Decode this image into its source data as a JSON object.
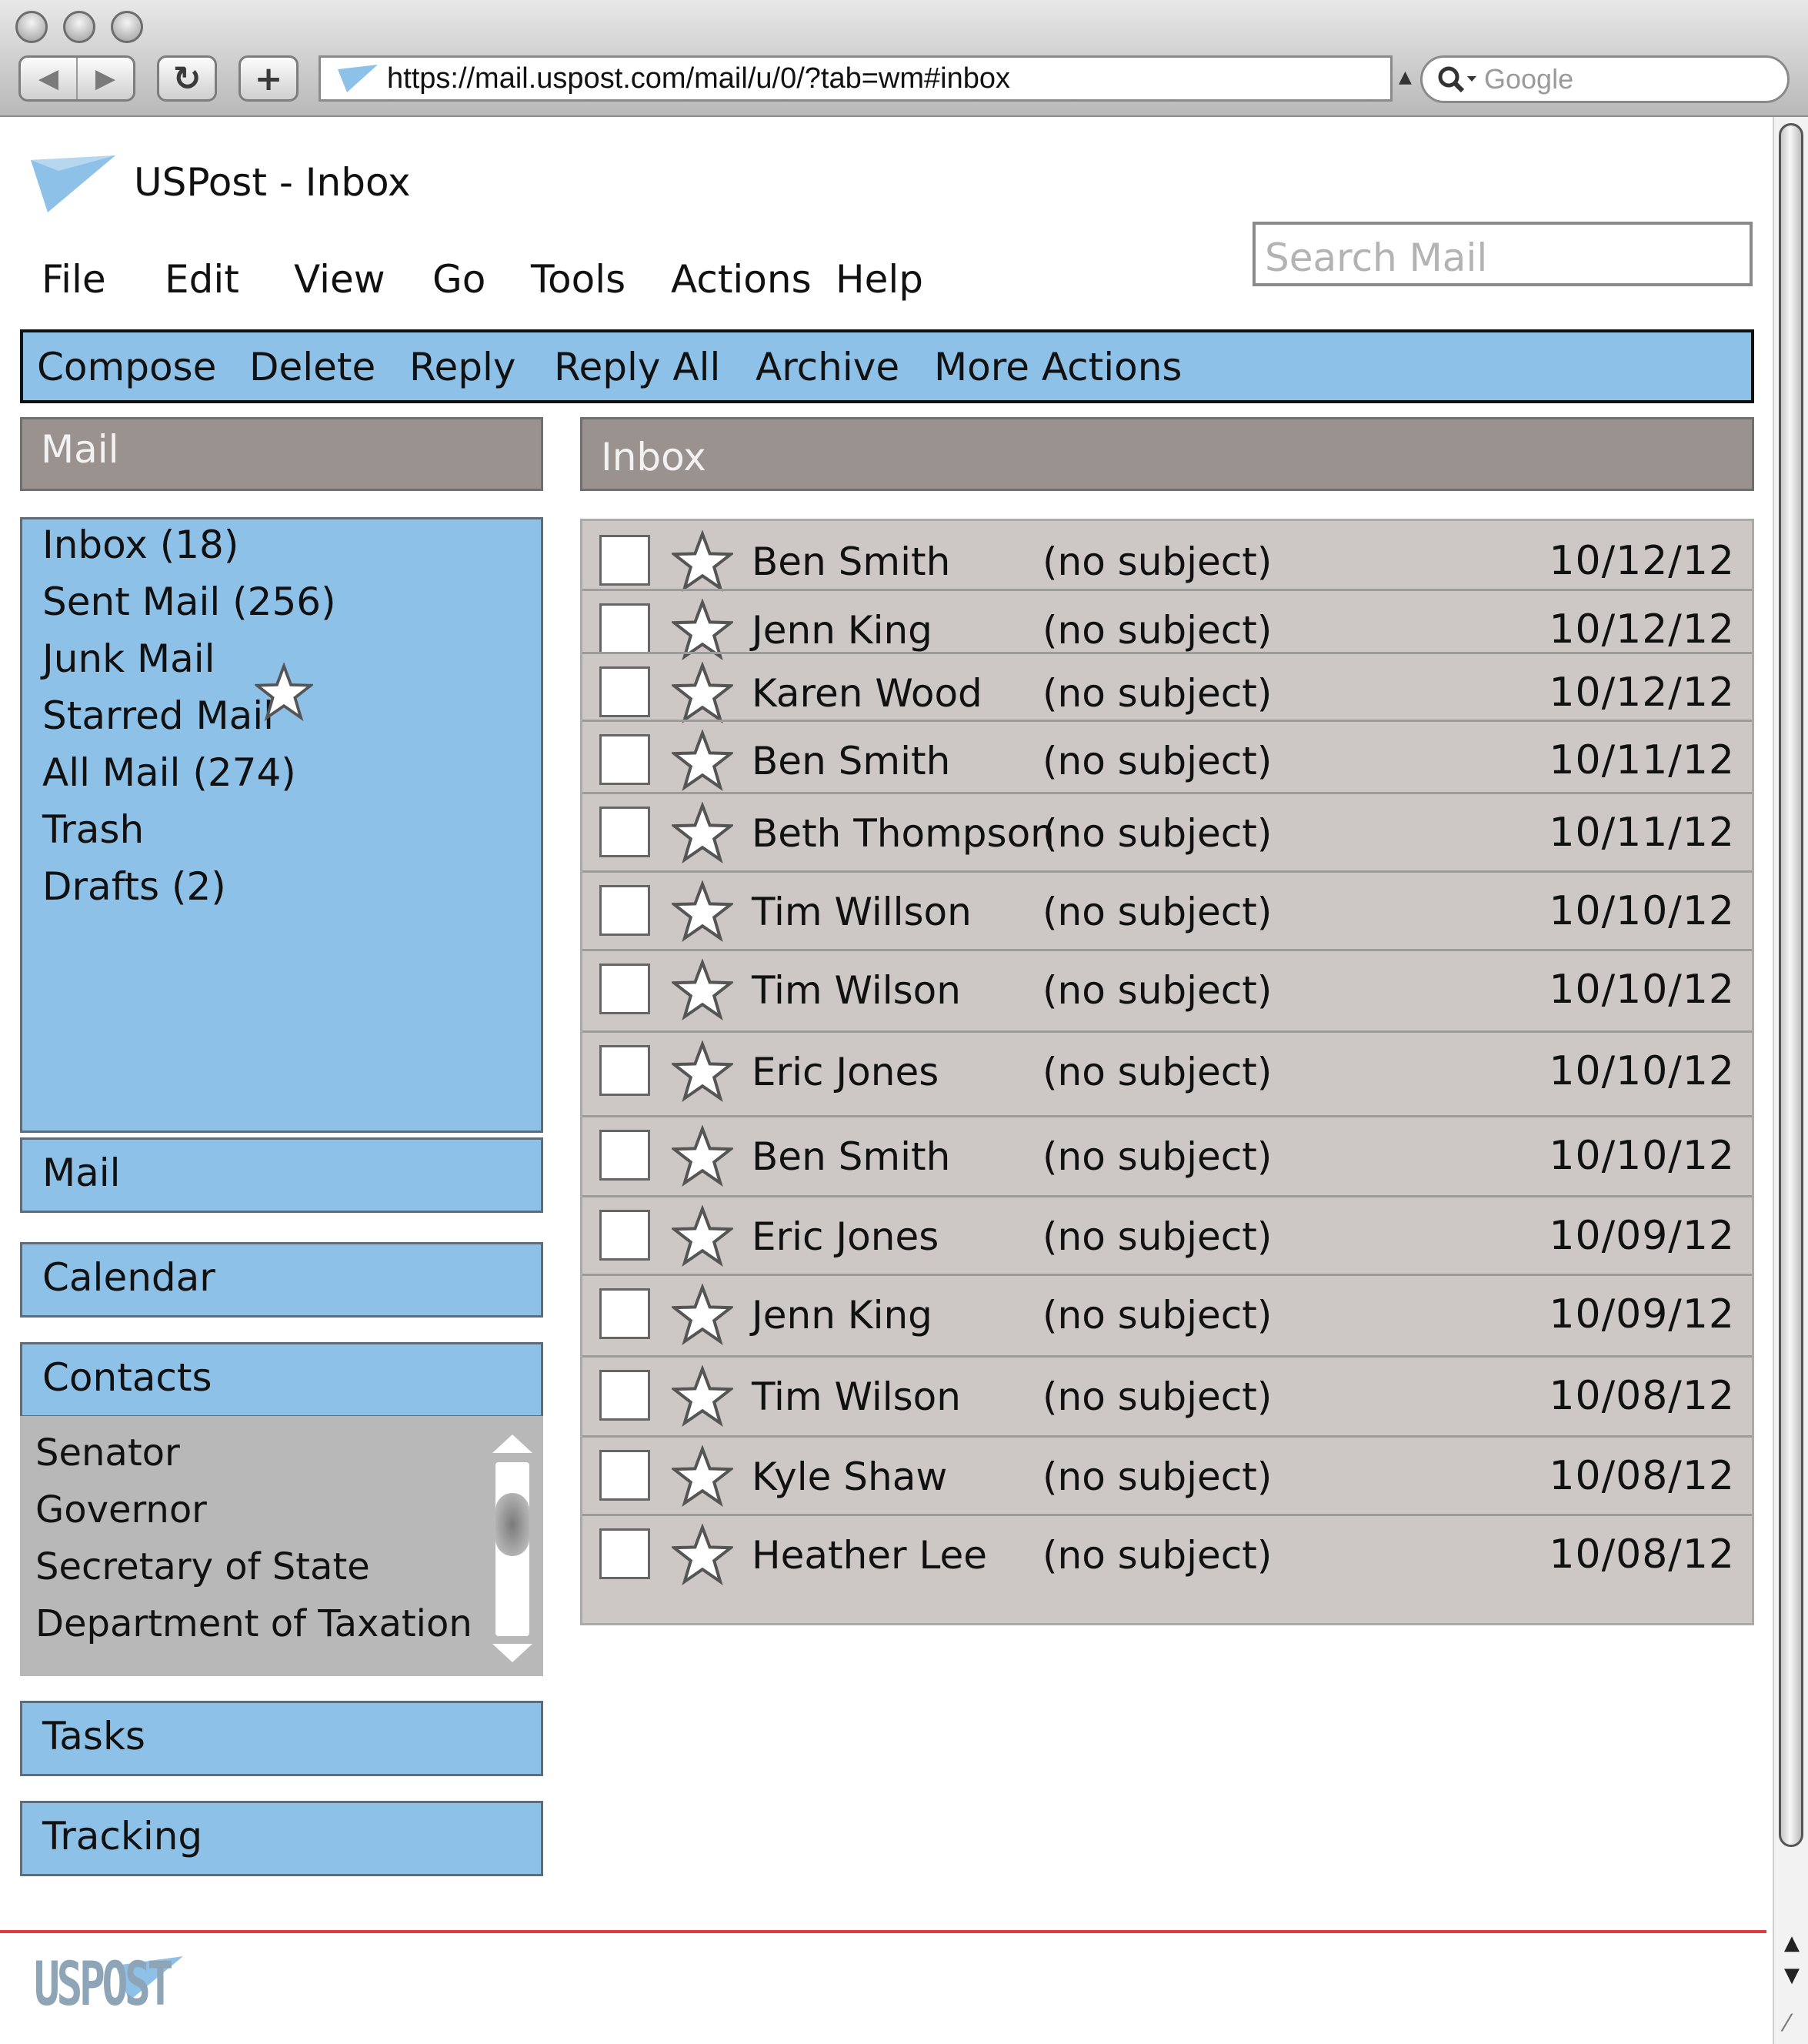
{
  "browser": {
    "url": "https://mail.uspost.com/mail/u/0/?tab=wm#inbox",
    "search_placeholder": "Google",
    "back_icon": "back-arrow-icon",
    "forward_icon": "forward-arrow-icon",
    "reload_icon": "reload-icon",
    "new_tab_icon": "plus-icon"
  },
  "app": {
    "title": "USPost - Inbox",
    "footer_brand": "USPOST",
    "accent_color": "#8ec1e8",
    "panel_gray": "#9a928e",
    "footer_line_color": "#e23a3a"
  },
  "menu": [
    "File",
    "Edit",
    "View",
    "Go",
    "Tools",
    "Actions",
    "Help"
  ],
  "search": {
    "placeholder": "Search Mail"
  },
  "toolbar": [
    "Compose",
    "Delete",
    "Reply",
    "Reply All",
    "Archive",
    "More Actions"
  ],
  "sidebar": {
    "header": "Mail",
    "folders": [
      "Inbox (18)",
      "Sent Mail (256)",
      "Junk Mail",
      "Starred Mail",
      "All Mail (274)",
      "Trash",
      "Drafts (2)"
    ],
    "sections": {
      "mail": "Mail",
      "calendar": "Calendar",
      "contacts": "Contacts",
      "tasks": "Tasks",
      "tracking": "Tracking"
    },
    "contacts": [
      "Senator",
      "Governor",
      "Secretary of State",
      "Department of Taxation"
    ]
  },
  "inbox": {
    "header": "Inbox",
    "messages": [
      {
        "sender": "Ben Smith",
        "subject": "(no subject)",
        "date": "10/12/12"
      },
      {
        "sender": "Jenn King",
        "subject": "(no subject)",
        "date": "10/12/12"
      },
      {
        "sender": "Karen Wood",
        "subject": "(no subject)",
        "date": "10/12/12"
      },
      {
        "sender": "Ben Smith",
        "subject": "(no subject)",
        "date": "10/11/12"
      },
      {
        "sender": "Beth Thompson",
        "subject": "(no subject)",
        "date": "10/11/12"
      },
      {
        "sender": "Tim Willson",
        "subject": "(no subject)",
        "date": "10/10/12"
      },
      {
        "sender": "Tim Wilson",
        "subject": "(no subject)",
        "date": "10/10/12"
      },
      {
        "sender": "Eric Jones",
        "subject": "(no subject)",
        "date": "10/10/12"
      },
      {
        "sender": "Ben Smith",
        "subject": "(no subject)",
        "date": "10/10/12"
      },
      {
        "sender": "Eric Jones",
        "subject": "(no subject)",
        "date": "10/09/12"
      },
      {
        "sender": "Jenn King",
        "subject": "(no subject)",
        "date": "10/09/12"
      },
      {
        "sender": "Tim Wilson",
        "subject": "(no subject)",
        "date": "10/08/12"
      },
      {
        "sender": "Kyle Shaw",
        "subject": "(no subject)",
        "date": "10/08/12"
      },
      {
        "sender": "Heather Lee",
        "subject": "(no subject)",
        "date": "10/08/12"
      }
    ]
  }
}
